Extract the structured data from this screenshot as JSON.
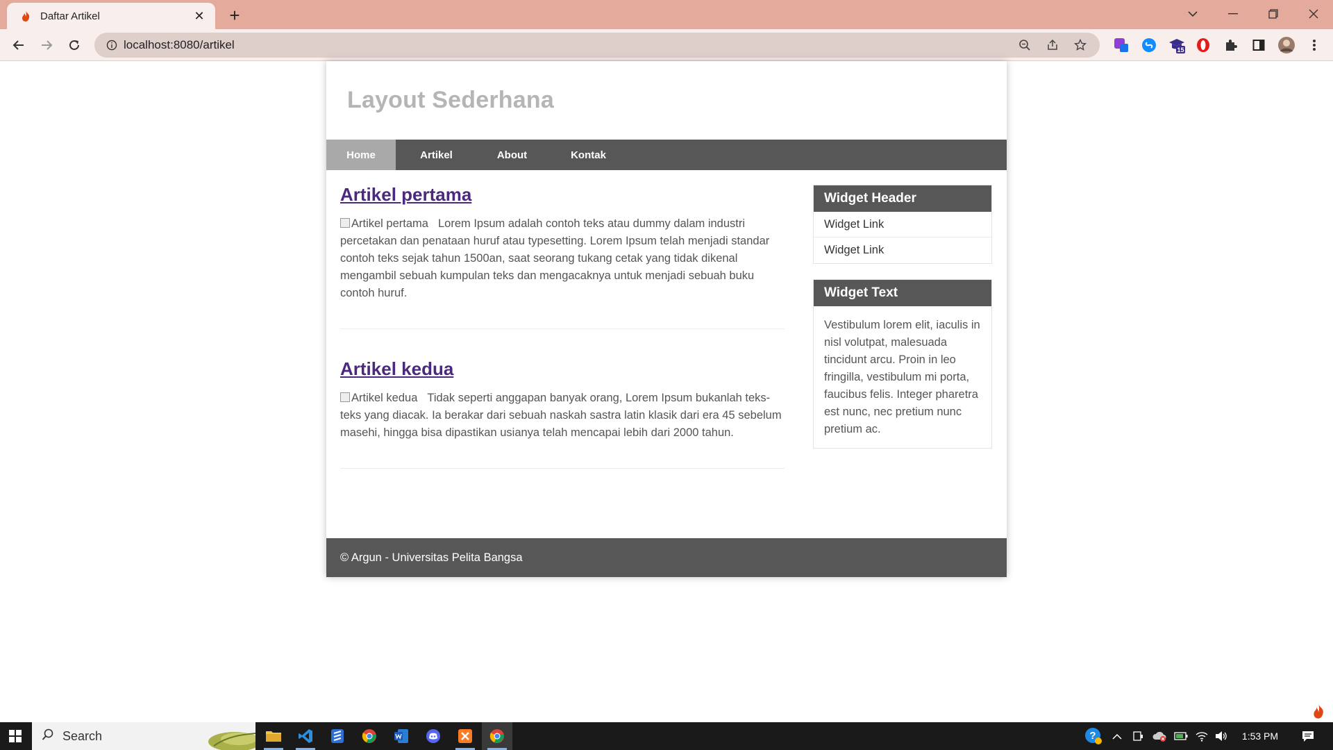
{
  "browser": {
    "tab_title": "Daftar Artikel",
    "close_symbol": "✕",
    "new_tab_symbol": "+",
    "url": "localhost:8080/artikel"
  },
  "page": {
    "site_title": "Layout Sederhana",
    "nav": [
      "Home",
      "Artikel",
      "About",
      "Kontak"
    ],
    "articles": [
      {
        "title": "Artikel pertama",
        "image_alt": "Artikel pertama",
        "body": "Lorem Ipsum adalah contoh teks atau dummy dalam industri percetakan dan penataan huruf atau typesetting. Lorem Ipsum telah menjadi standar contoh teks sejak tahun 1500an, saat seorang tukang cetak yang tidak dikenal mengambil sebuah kumpulan teks dan mengacaknya untuk menjadi sebuah buku contoh huruf."
      },
      {
        "title": "Artikel kedua",
        "image_alt": "Artikel kedua",
        "body": "Tidak seperti anggapan banyak orang, Lorem Ipsum bukanlah teks-teks yang diacak. Ia berakar dari sebuah naskah sastra latin klasik dari era 45 sebelum masehi, hingga bisa dipastikan usianya telah mencapai lebih dari 2000 tahun."
      }
    ],
    "widget_header": {
      "title": "Widget Header",
      "links": [
        "Widget Link",
        "Widget Link"
      ]
    },
    "widget_text": {
      "title": "Widget Text",
      "body": "Vestibulum lorem elit, iaculis in nisl volutpat, malesuada tincidunt arcu. Proin in leo fringilla, vestibulum mi porta, faucibus felis. Integer pharetra est nunc, nec pretium nunc pretium ac."
    },
    "footer": "© Argun - Universitas Pelita Bangsa"
  },
  "taskbar": {
    "search_label": "Search",
    "time": "1:53 PM",
    "extension_badge": "15"
  },
  "colors": {
    "tab_strip": "#e4ab9d",
    "toolbar": "#f8eeeb",
    "nav_bar": "#575757",
    "nav_active": "#a9a9a9",
    "link": "#4b2a7d"
  }
}
